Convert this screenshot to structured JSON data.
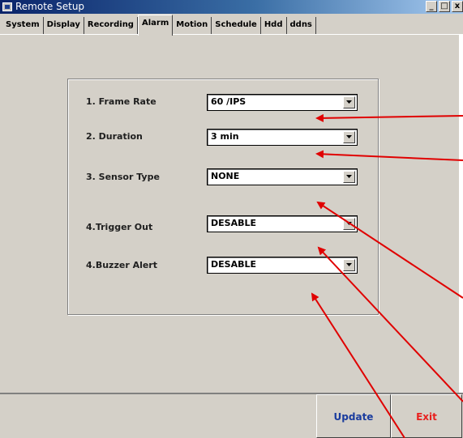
{
  "window": {
    "title": "Remote Setup",
    "controls": [
      "_",
      "□",
      "x"
    ]
  },
  "tabs": [
    {
      "label": "System",
      "active": false
    },
    {
      "label": "Display",
      "active": false
    },
    {
      "label": "Recording",
      "active": false
    },
    {
      "label": "Alarm",
      "active": true
    },
    {
      "label": "Motion",
      "active": false
    },
    {
      "label": "Schedule",
      "active": false
    },
    {
      "label": "Hdd",
      "active": false
    },
    {
      "label": "ddns",
      "active": false
    }
  ],
  "fields": [
    {
      "label": "1. Frame Rate",
      "value": "60  /IPS"
    },
    {
      "label": "2. Duration",
      "value": "3   min"
    },
    {
      "label": "3. Sensor Type",
      "value": "NONE"
    },
    {
      "label": "4.Trigger Out",
      "value": "DESABLE"
    },
    {
      "label": "4.Buzzer Alert",
      "value": "DESABLE"
    }
  ],
  "buttons": {
    "update_label": "Update",
    "exit_label": "Exit"
  },
  "colors": {
    "titlebar_start": "#0a246a",
    "update_text": "#1a3c9e",
    "exit_text": "#e8201e",
    "annotation_arrow": "#e00000"
  },
  "icons": {
    "app": "app-window-icon",
    "dropdown": "chevron-down-icon"
  }
}
